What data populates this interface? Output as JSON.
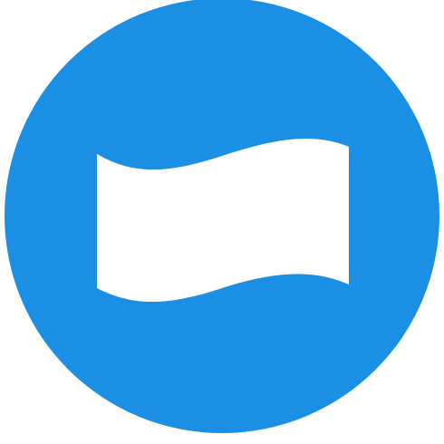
{
  "icon": {
    "name": "flag-icon",
    "background_shape": "circle",
    "colors": {
      "circle": "#1a8fe3",
      "flag": "#ffffff",
      "page_background": "#ffffff"
    }
  }
}
